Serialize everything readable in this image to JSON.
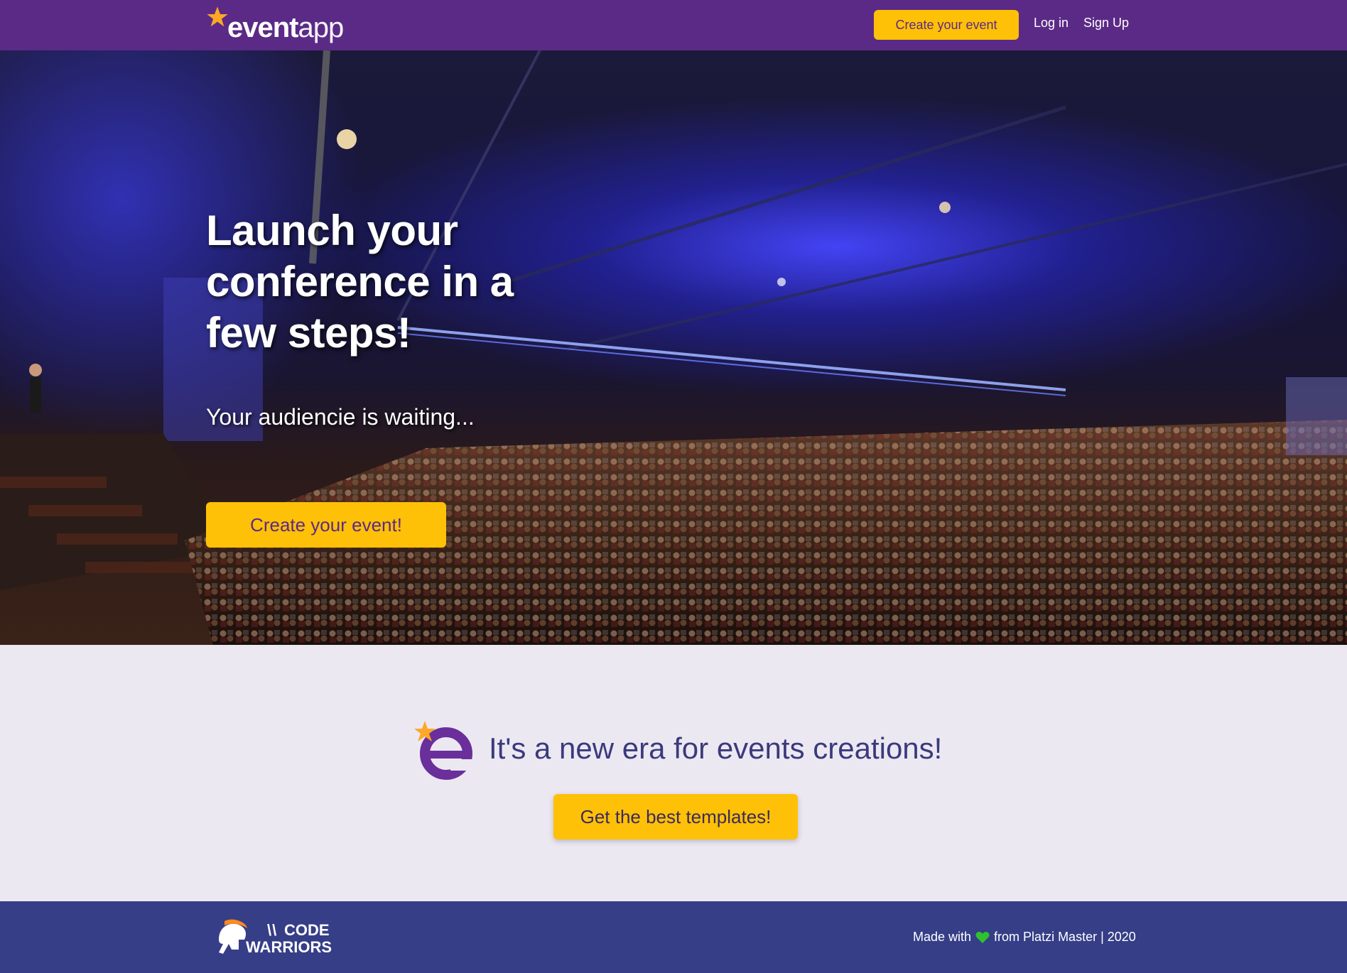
{
  "navbar": {
    "logo_bold": "event",
    "logo_light": "app",
    "create_label": "Create your event",
    "login_label": "Log in",
    "signup_label": "Sign Up"
  },
  "hero": {
    "title": "Launch your conference in a few steps!",
    "subtitle": "Your audiencie is waiting...",
    "cta_label": "Create your event!"
  },
  "tagline": {
    "text": "It's a new era for events creations!",
    "cta_label": "Get the best templates!"
  },
  "footer": {
    "logo_line1": "CODE",
    "logo_line2": "WARRIORS",
    "made_with": "Made with",
    "from_text": "from Platzi Master | 2020"
  },
  "colors": {
    "primary": "#5b2a86",
    "accent": "#ffc107",
    "footer_bg": "#363e87",
    "section_bg": "#ece8f2",
    "heart": "#2ec22e"
  },
  "icons": [
    "star-icon",
    "heart-icon",
    "spartan-helmet-icon",
    "e-logo-icon"
  ]
}
